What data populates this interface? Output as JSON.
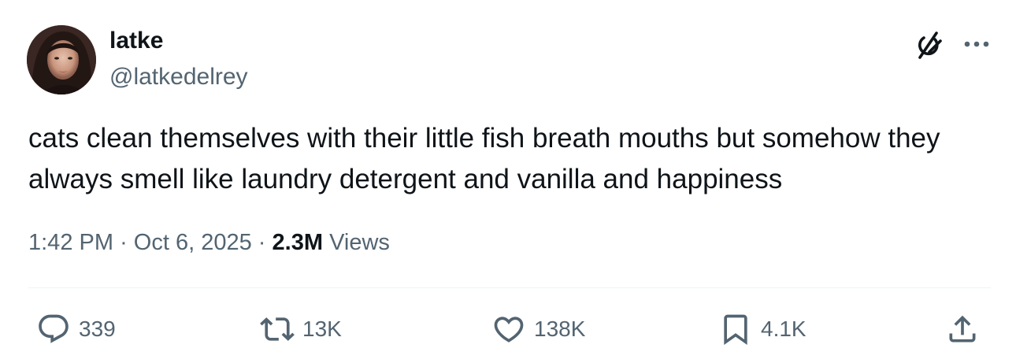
{
  "author": {
    "display_name": "latke",
    "handle": "@latkedelrey"
  },
  "tweet": {
    "text": "cats clean themselves with their little fish breath mouths but somehow they always smell like laundry detergent and vanilla and happiness"
  },
  "meta": {
    "time": "1:42 PM",
    "separator": "·",
    "date": "Oct 6, 2025",
    "views_count": "2.3M",
    "views_label": "Views"
  },
  "actions": {
    "replies": "339",
    "reposts": "13K",
    "likes": "138K",
    "bookmarks": "4.1K"
  },
  "icons": {
    "top_right": [
      "grok-icon",
      "more-icon"
    ],
    "actions": [
      "reply-icon",
      "repost-icon",
      "like-icon",
      "bookmark-icon",
      "share-icon"
    ]
  },
  "colors": {
    "text_primary": "#0f1419",
    "text_secondary": "#536471",
    "divider": "#eff3f4",
    "background": "#ffffff"
  }
}
